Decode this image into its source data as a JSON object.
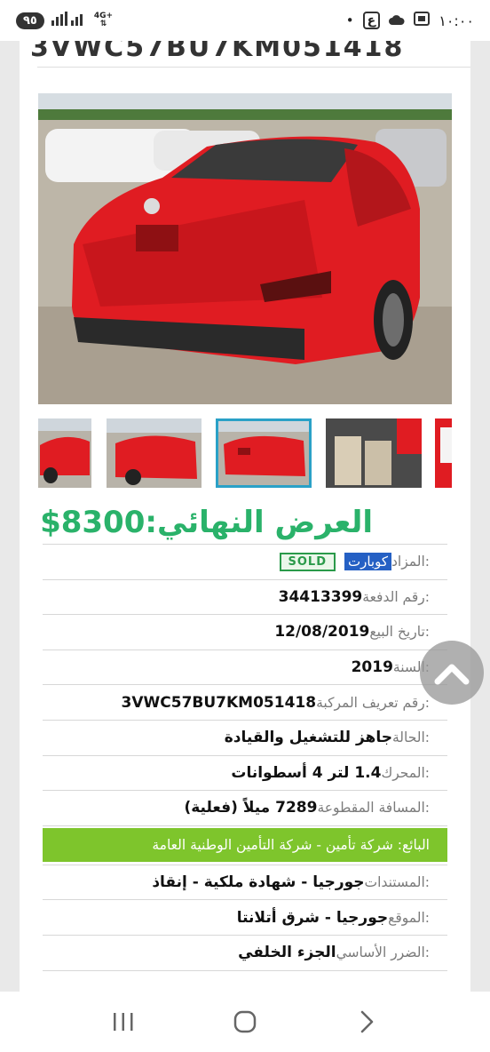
{
  "status_bar": {
    "battery": "٩٥",
    "network": "4G+",
    "time": "١٠:٠٠",
    "app_letter": "ع"
  },
  "listing": {
    "vin_title": "3VWC57BU7KM051418",
    "final_offer_label": "العرض النهائي:",
    "final_offer_value": "$8300",
    "rows": {
      "auction": {
        "label": "المزاد:",
        "value": "كوبارت",
        "badge": "SOLD"
      },
      "lot": {
        "label": "رقم الدفعة:",
        "value": "34413399"
      },
      "sale_date": {
        "label": "تاريخ البيع:",
        "value": "12/08/2019"
      },
      "year": {
        "label": "السنة:",
        "value": "2019"
      },
      "vin": {
        "label": "رقم تعريف المركبة:",
        "value": "3VWC57BU7KM051418"
      },
      "condition": {
        "label": "الحالة:",
        "value": "جاهز للتشغيل والقيادة"
      },
      "engine": {
        "label": "المحرك:",
        "value": "1.4 لتر 4 أسطوانات"
      },
      "odometer": {
        "label": "المسافة المقطوعة:",
        "value": "7289 ميلاً (فعلية)"
      },
      "seller": "البائع: شركة تأمين - شركة التأمين الوطنية العامة",
      "documents": {
        "label": "المستندات:",
        "value": "جورجيا - شهادة ملكية - إنقاذ"
      },
      "location": {
        "label": "الموقع:",
        "value": "جورجيا - شرق أتلانتا"
      },
      "damage": {
        "label": "الضرر الأساسي:",
        "value": "الجزء الخلفي"
      }
    }
  },
  "colors": {
    "price_green": "#2ab26a",
    "seller_bar": "#7ec52c",
    "thumb_active_border": "#2aa1c7",
    "auction_chip": "#2560c4"
  },
  "icons": [
    "signal-icon",
    "scroll-top-icon",
    "recents-icon",
    "home-icon",
    "back-icon",
    "cloud-icon",
    "screenshot-icon"
  ]
}
